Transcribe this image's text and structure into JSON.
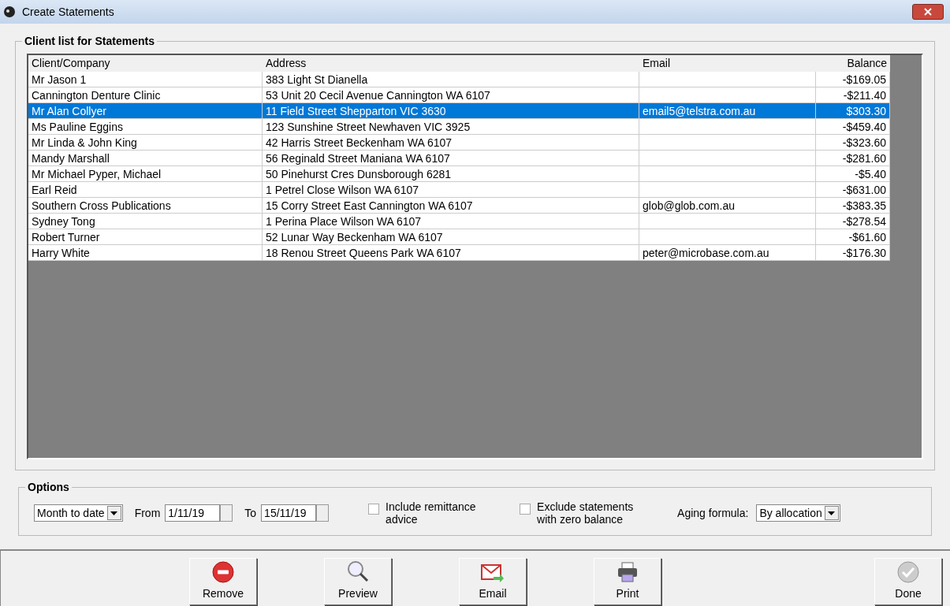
{
  "window": {
    "title": "Create Statements"
  },
  "client_list": {
    "title": "Client list for Statements",
    "columns": [
      "Client/Company",
      "Address",
      "Email",
      "Balance"
    ],
    "rows": [
      {
        "client": "Mr Jason 1",
        "address": "383 Light St Dianella",
        "balance": "-$169.05",
        "selected": false
      },
      {
        "client": "Cannington Denture Clinic",
        "address": "53 Unit 20 Cecil Avenue Cannington WA 6107",
        "balance": "-$211.40",
        "selected": false
      },
      {
        "client": "Mr Alan Collyer",
        "address": "11 Field Street Shepparton VIC 3630",
        "email": "email5@telstra.com.au",
        "balance": "$303.30",
        "selected": true
      },
      {
        "client": "Ms Pauline Eggins",
        "address": "123 Sunshine Street Newhaven VIC 3925",
        "balance": "-$459.40",
        "selected": false
      },
      {
        "client": "Mr Linda & John King",
        "address": "42 Harris Street Beckenham WA 6107",
        "balance": "-$323.60",
        "selected": false
      },
      {
        "client": "Mandy Marshall",
        "address": "56 Reginald Street Maniana WA 6107",
        "balance": "-$281.60",
        "selected": false
      },
      {
        "client": "Mr Michael Pyper, Michael",
        "address": "50 Pinehurst Cres Dunsborough 6281",
        "balance": "-$5.40",
        "selected": false
      },
      {
        "client": "Earl Reid",
        "address": "1 Petrel Close Wilson WA 6107",
        "balance": "-$631.00",
        "selected": false
      },
      {
        "client": "Southern Cross Publications",
        "address": "15 Corry Street East Cannington WA 6107",
        "email": "glob@glob.com.au",
        "balance": "-$383.35",
        "selected": false
      },
      {
        "client": "Sydney Tong",
        "address": "1 Perina Place Wilson WA 6107",
        "balance": "-$278.54",
        "selected": false
      },
      {
        "client": "Robert Turner",
        "address": "52 Lunar Way Beckenham WA 6107",
        "balance": "-$61.60",
        "selected": false
      },
      {
        "client": "Harry White",
        "address": "18 Renou Street Queens Park WA 6107",
        "email": "peter@microbase.com.au",
        "balance": "-$176.30",
        "selected": false
      }
    ]
  },
  "options": {
    "title": "Options",
    "period": "Month to date",
    "from_label": "From",
    "from": "1/11/19",
    "to_label": "To",
    "to": "15/11/19",
    "include_remittance": {
      "label": "Include remittance advice",
      "checked": false
    },
    "exclude_zero": {
      "label": "Exclude statements with zero balance",
      "checked": false
    },
    "aging_label": "Aging formula:",
    "aging": "By allocation"
  },
  "buttons": [
    {
      "kind": "remove",
      "label": "Remove"
    },
    {
      "kind": "preview",
      "label": "Preview"
    },
    {
      "kind": "email",
      "label": "Email"
    },
    {
      "kind": "print",
      "label": "Print"
    },
    {
      "kind": "done",
      "label": "Done"
    }
  ]
}
